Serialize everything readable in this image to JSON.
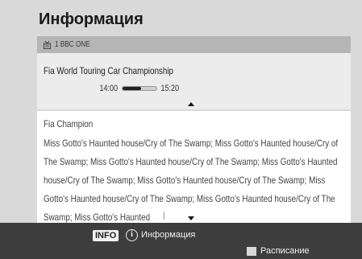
{
  "title": "Информация",
  "channel": {
    "icon": "tv-icon",
    "name": "1 BBC ONE"
  },
  "program": {
    "title": "Fia World Touring Car Championship",
    "start_time": "14:00",
    "end_time": "15:20",
    "progress": 0.55
  },
  "description": {
    "title": "Fia Champion",
    "text": "Miss Gotto's Haunted house/Cry of The Swamp; Miss Gotto's Haunted house/Cry of The Swamp; Miss Gotto's Haunted house/Cry of The Swamp; Miss Gotto's Haunted house/Cry of The Swamp; Miss Gotto's Haunted house/Cry of The Swamp; Miss Gotto's Haunted house/Cry of The Swamp; Miss Gotto's Haunted house/Cry of The Swamp; Miss Gotto's Haunted"
  },
  "footer": {
    "info_key": "INFO",
    "info_icon": "info-circle-icon",
    "info_label": "Информация",
    "schedule_label": "Расписание",
    "schedule_color": "#d8d8d8"
  },
  "colors": {
    "background": "#d9d9d9",
    "footer": "#3e3e3e",
    "channel_bar": "#b5b5b5"
  }
}
